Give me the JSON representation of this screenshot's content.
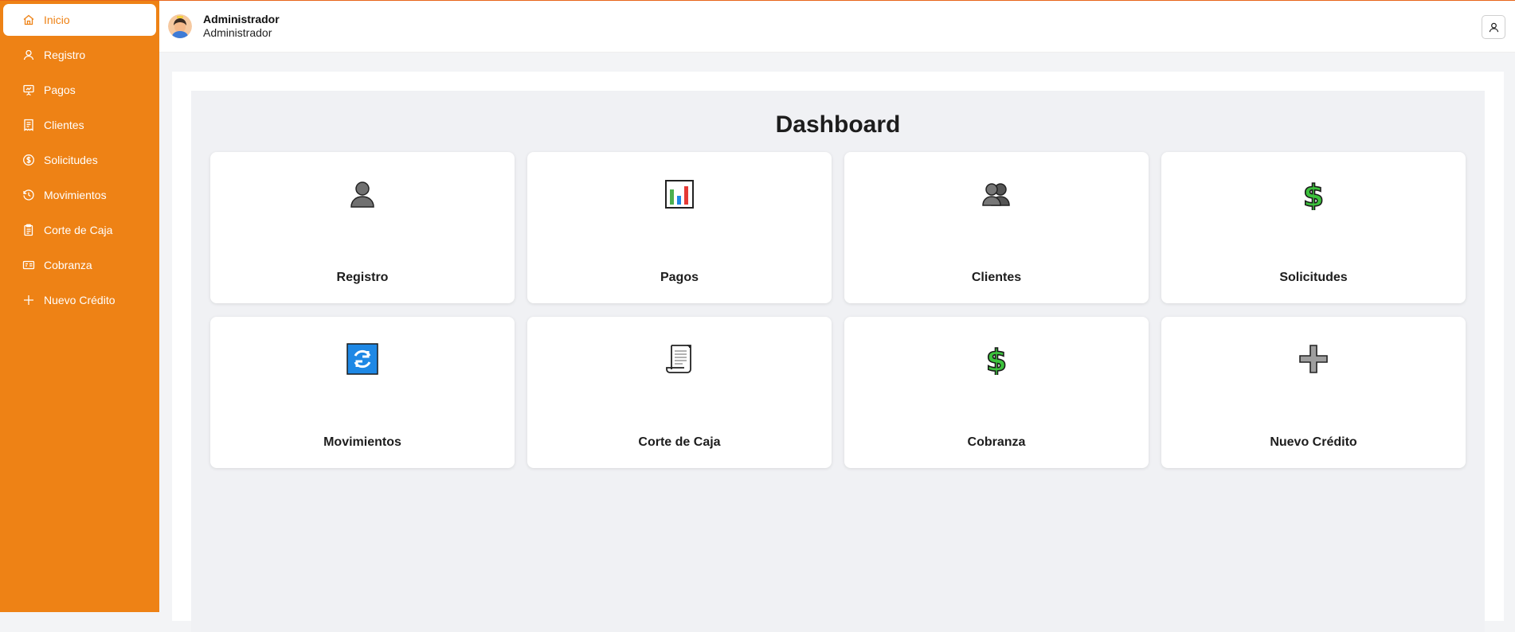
{
  "sidebar": {
    "items": [
      {
        "label": "Inicio",
        "icon": "home-icon",
        "active": true
      },
      {
        "label": "Registro",
        "icon": "user-icon"
      },
      {
        "label": "Pagos",
        "icon": "presentation-icon"
      },
      {
        "label": "Clientes",
        "icon": "receipt-icon"
      },
      {
        "label": "Solicitudes",
        "icon": "dollar-circle-icon"
      },
      {
        "label": "Movimientos",
        "icon": "history-icon"
      },
      {
        "label": "Corte de Caja",
        "icon": "clipboard-icon"
      },
      {
        "label": "Cobranza",
        "icon": "card-icon"
      },
      {
        "label": "Nuevo Crédito",
        "icon": "plus-icon"
      }
    ]
  },
  "header": {
    "user_name": "Administrador",
    "user_role": "Administrador"
  },
  "dashboard": {
    "title": "Dashboard",
    "cards": [
      {
        "label": "Registro",
        "icon": "person-icon"
      },
      {
        "label": "Pagos",
        "icon": "bar-chart-icon"
      },
      {
        "label": "Clientes",
        "icon": "people-icon"
      },
      {
        "label": "Solicitudes",
        "icon": "dollar-sign-icon"
      },
      {
        "label": "Movimientos",
        "icon": "refresh-icon"
      },
      {
        "label": "Corte de Caja",
        "icon": "scroll-icon"
      },
      {
        "label": "Cobranza",
        "icon": "dollar-sign-icon"
      },
      {
        "label": "Nuevo Crédito",
        "icon": "plus-sign-icon"
      }
    ]
  },
  "colors": {
    "accent": "#ee8215",
    "panel_bg": "#f0f1f4"
  }
}
